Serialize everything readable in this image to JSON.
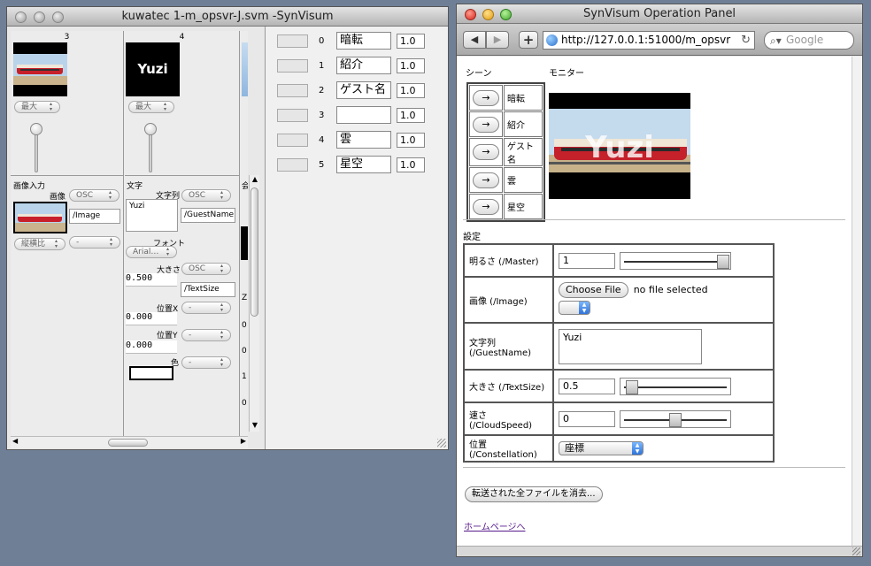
{
  "left_window": {
    "title": "kuwatec 1-m_opsvr-J.svm -SynVisum",
    "column_3": {
      "number": "3",
      "preset": "最大",
      "section_label": "画像入力",
      "image_label": "画像",
      "osc_mode": "OSC",
      "address": "/Image",
      "aspect": "縦横比",
      "aspect_mode": "-"
    },
    "column_4": {
      "number": "4",
      "thumbnail_text": "Yuzi",
      "preset": "最大",
      "section_label": "文字",
      "string_label": "文字列",
      "string_value": "Yuzi",
      "string_osc": "OSC",
      "string_address": "/GuestName",
      "font_label": "フォント",
      "font_value": "Arial…",
      "size_label": "大きさ",
      "size_value": "0.500",
      "size_osc": "OSC",
      "size_address": "/TextSize",
      "posx_label": "位置X",
      "posx_value": "0.000",
      "posx_mode": "-",
      "posy_label": "位置Y",
      "posy_value": "0.000",
      "posy_mode": "-",
      "color_label": "色",
      "color_mode": "-"
    },
    "column_5_fragments": [
      "会",
      "Z",
      "0",
      "0",
      "1",
      "0"
    ],
    "scene_list": [
      {
        "index": "0",
        "name": "暗転",
        "value": "1.0"
      },
      {
        "index": "1",
        "name": "紹介",
        "value": "1.0"
      },
      {
        "index": "2",
        "name": "ゲスト名",
        "value": "1.0"
      },
      {
        "index": "3",
        "name": "",
        "value": "1.0"
      },
      {
        "index": "4",
        "name": "雲",
        "value": "1.0"
      },
      {
        "index": "5",
        "name": "星空",
        "value": "1.0"
      }
    ]
  },
  "browser": {
    "title": "SynVisum Operation Panel",
    "back_glyph": "◀",
    "forward_glyph": "▶",
    "add_glyph": "+",
    "reload_glyph": "↻",
    "url": "http://127.0.0.1:51000/m_opsvr",
    "search_placeholder": "Google",
    "scene_header": "シーン",
    "monitor_header": "モニター",
    "monitor_text": "Yuzi",
    "arrow_glyph": "→",
    "scenes": [
      "暗転",
      "紹介",
      "ゲスト名",
      "雲",
      "星空"
    ],
    "settings_header": "設定",
    "settings": {
      "brightness_label": "明るさ (/Master)",
      "brightness_value": "1",
      "brightness_level": 1.0,
      "image_label": "画像 (/Image)",
      "choose_file": "Choose File",
      "no_file": "no file selected",
      "string_label": "文字列 (/GuestName)",
      "string_value": "Yuzi",
      "size_label": "大きさ (/TextSize)",
      "size_value": "0.5",
      "size_level": 0.05,
      "speed_label": "速さ (/CloudSpeed)",
      "speed_value": "0",
      "speed_level": 0.5,
      "position_label": "位置 (/Constellation)",
      "position_value": "座標"
    },
    "clear_button": "転送された全ファイルを消去...",
    "homepage_link": "ホームページへ"
  }
}
